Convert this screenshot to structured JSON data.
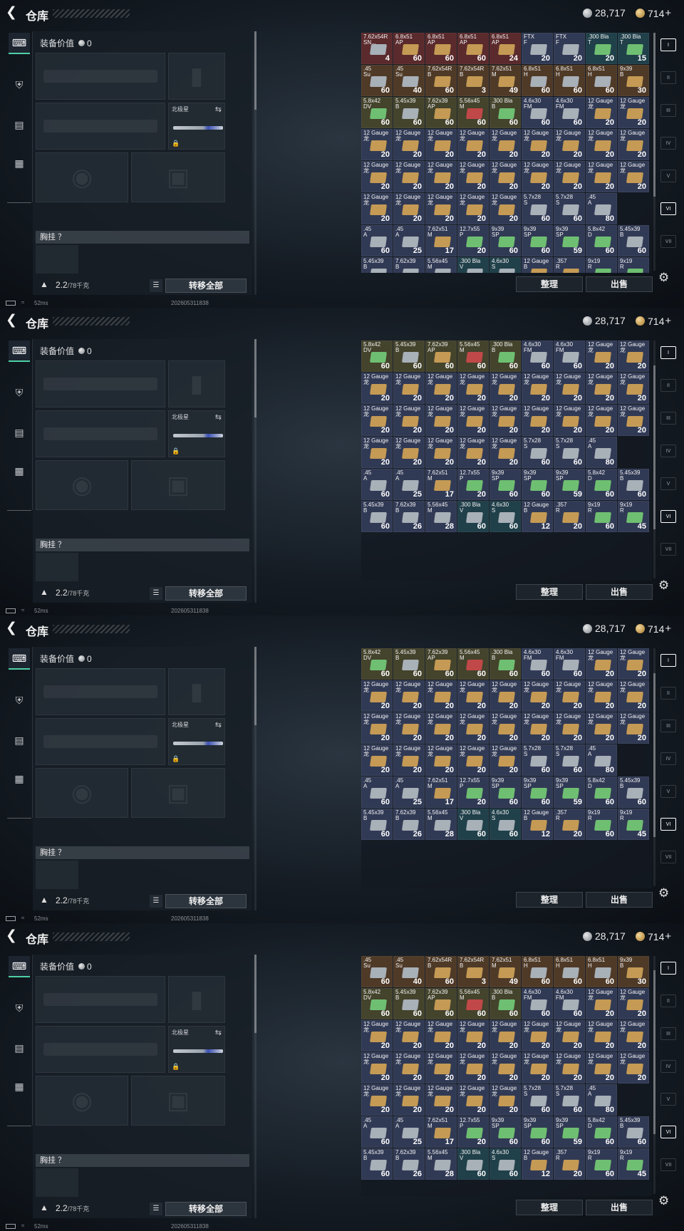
{
  "header": {
    "title": "仓库",
    "silver": "28,717",
    "gold": "714",
    "gold_plus": "+"
  },
  "equipment": {
    "value_label": "装备价值",
    "value": "0",
    "melee_label": "北极星",
    "chest_label": "胸挂 ？",
    "weight": "2.2",
    "weight_max": "/78千克",
    "transfer_button": "转移全部"
  },
  "actions": {
    "sort": "整理",
    "sell": "出售"
  },
  "status": {
    "ping": "52ms",
    "timestamp": "202605311838"
  },
  "colors": {
    "red": "#5a2a2c",
    "brown": "#4f3a27",
    "olive": "#44432c",
    "slate": "#313a55",
    "teal": "#20404a",
    "gold_box": "#c49a55",
    "green_box": "#6fbf72",
    "red_box": "#c04848",
    "silver_box": "#a8b0b8"
  },
  "stash_rows": [
    [
      [
        "7.62x54R\nSN...",
        "4",
        "red",
        "silver_box"
      ],
      [
        "6.8x51\nAP",
        "60",
        "red",
        "gold_box"
      ],
      [
        "6.8x51\nAP",
        "60",
        "red",
        "gold_box"
      ],
      [
        "6.8x51\nAP",
        "60",
        "red",
        "gold_box"
      ],
      [
        "6.8x51\nAP",
        "24",
        "red",
        "gold_box"
      ],
      [
        "FTX\nF",
        "20",
        "slate",
        "silver_box"
      ],
      [
        "FTX\nF",
        "20",
        "slate",
        "silver_box"
      ],
      [
        ".300 Bla\nT",
        "20",
        "teal",
        "green_box"
      ],
      [
        ".300 Bla\nT",
        "15",
        "teal",
        "green_box"
      ]
    ],
    [
      [
        ".45\nSu",
        "60",
        "brown",
        "silver_box"
      ],
      [
        ".45\nSu",
        "40",
        "brown",
        "silver_box"
      ],
      [
        "7.62x54R\nB",
        "60",
        "brown",
        "gold_box"
      ],
      [
        "7.62x54R\nB",
        "3",
        "brown",
        "gold_box"
      ],
      [
        "7.62x51\nM",
        "49",
        "brown",
        "gold_box"
      ],
      [
        "6.8x51\nH",
        "60",
        "brown",
        "silver_box"
      ],
      [
        "6.8x51\nH",
        "60",
        "brown",
        "silver_box"
      ],
      [
        "6.8x51\nH",
        "60",
        "brown",
        "silver_box"
      ],
      [
        "9x39\nB",
        "30",
        "brown",
        "gold_box"
      ]
    ],
    [
      [
        "5.8x42\nDV",
        "60",
        "olive",
        "green_box"
      ],
      [
        "5.45x39\nB",
        "60",
        "olive",
        "silver_box"
      ],
      [
        "7.62x39\nAP",
        "60",
        "olive",
        "gold_box"
      ],
      [
        "5.56x45\nM",
        "60",
        "olive",
        "red_box"
      ],
      [
        ".300 Bla\nB",
        "60",
        "olive",
        "green_box"
      ],
      [
        "4.6x30\nFM",
        "60",
        "slate",
        "silver_box"
      ],
      [
        "4.6x30\nFM",
        "60",
        "slate",
        "silver_box"
      ],
      [
        "12 Gauge\n龙",
        "20",
        "slate",
        "gold_box"
      ],
      [
        "12 Gauge\n龙",
        "20",
        "slate",
        "gold_box"
      ]
    ],
    [
      [
        "12 Gauge\n龙",
        "20",
        "slate",
        "gold_box"
      ],
      [
        "12 Gauge\n龙",
        "20",
        "slate",
        "gold_box"
      ],
      [
        "12 Gauge\n龙",
        "20",
        "slate",
        "gold_box"
      ],
      [
        "12 Gauge\n龙",
        "20",
        "slate",
        "gold_box"
      ],
      [
        "12 Gauge\n龙",
        "20",
        "slate",
        "gold_box"
      ],
      [
        "12 Gauge\n龙",
        "20",
        "slate",
        "gold_box"
      ],
      [
        "12 Gauge\n龙",
        "20",
        "slate",
        "gold_box"
      ],
      [
        "12 Gauge\n龙",
        "20",
        "slate",
        "gold_box"
      ],
      [
        "12 Gauge\n龙",
        "20",
        "slate",
        "gold_box"
      ]
    ],
    [
      [
        "12 Gauge\n龙",
        "20",
        "slate",
        "gold_box"
      ],
      [
        "12 Gauge\n龙",
        "20",
        "slate",
        "gold_box"
      ],
      [
        "12 Gauge\n龙",
        "20",
        "slate",
        "gold_box"
      ],
      [
        "12 Gauge\n龙",
        "20",
        "slate",
        "gold_box"
      ],
      [
        "12 Gauge\n龙",
        "20",
        "slate",
        "gold_box"
      ],
      [
        "12 Gauge\n龙",
        "20",
        "slate",
        "gold_box"
      ],
      [
        "12 Gauge\n龙",
        "20",
        "slate",
        "gold_box"
      ],
      [
        "12 Gauge\n龙",
        "20",
        "slate",
        "gold_box"
      ],
      [
        "12 Gauge\n龙",
        "20",
        "slate",
        "gold_box"
      ]
    ],
    [
      [
        "12 Gauge\n龙",
        "20",
        "slate",
        "gold_box"
      ],
      [
        "12 Gauge\n龙",
        "20",
        "slate",
        "gold_box"
      ],
      [
        "12 Gauge\n龙",
        "20",
        "slate",
        "gold_box"
      ],
      [
        "12 Gauge\n龙",
        "20",
        "slate",
        "gold_box"
      ],
      [
        "12 Gauge\n龙",
        "20",
        "slate",
        "gold_box"
      ],
      [
        "5.7x28\nS",
        "60",
        "slate",
        "silver_box"
      ],
      [
        "5.7x28\nS",
        "60",
        "slate",
        "silver_box"
      ],
      [
        ".45\nA",
        "80",
        "slate",
        "silver_box"
      ]
    ],
    [
      [
        ".45\nA",
        "60",
        "slate",
        "silver_box"
      ],
      [
        ".45\nA",
        "25",
        "slate",
        "silver_box"
      ],
      [
        "7.62x51\nM",
        "17",
        "slate",
        "gold_box"
      ],
      [
        "12.7x55\nP",
        "20",
        "slate",
        "green_box"
      ],
      [
        "9x39\nSP",
        "60",
        "slate",
        "green_box"
      ],
      [
        "9x39\nSP",
        "60",
        "slate",
        "green_box"
      ],
      [
        "9x39\nSP",
        "59",
        "slate",
        "green_box"
      ],
      [
        "5.8x42\nD",
        "60",
        "slate",
        "green_box"
      ],
      [
        "5.45x39\nB",
        "60",
        "slate",
        "silver_box"
      ]
    ],
    [
      [
        "5.45x39\nB",
        "60",
        "slate",
        "silver_box"
      ],
      [
        "7.62x39\nB",
        "26",
        "slate",
        "silver_box"
      ],
      [
        "5.56x45\nM",
        "28",
        "slate",
        "silver_box"
      ],
      [
        ".300 Bla\nV",
        "60",
        "teal",
        "silver_box"
      ],
      [
        "4.6x30\nS",
        "60",
        "teal",
        "silver_box"
      ],
      [
        "12 Gauge\nB",
        "12",
        "slate",
        "gold_box"
      ],
      [
        ".357\nR",
        "20",
        "slate",
        "gold_box"
      ],
      [
        "9x19\nR",
        "60",
        "slate",
        "green_box"
      ],
      [
        "9x19\nR",
        "45",
        "slate",
        "green_box"
      ]
    ]
  ],
  "frames": [
    {
      "scroll_rows": 0,
      "scroll_thumb": 0.0
    },
    {
      "scroll_rows": 2,
      "scroll_thumb": 0.35
    },
    {
      "scroll_rows": 2,
      "scroll_thumb": 0.35
    },
    {
      "scroll_rows": 1,
      "scroll_thumb": 0.2
    }
  ],
  "right_rail": [
    "I",
    "II",
    "III",
    "IV",
    "V",
    "VI",
    "VII"
  ]
}
